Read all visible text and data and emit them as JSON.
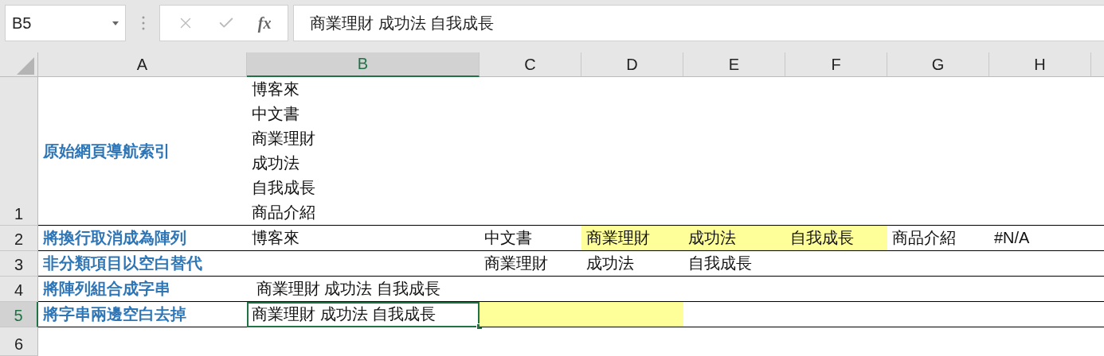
{
  "formula_bar": {
    "name_box": "B5",
    "function_label": "fx",
    "formula": "商業理財 成功法 自我成長"
  },
  "columns": [
    {
      "label": "A",
      "selected": false
    },
    {
      "label": "B",
      "selected": true
    },
    {
      "label": "C",
      "selected": false
    },
    {
      "label": "D",
      "selected": false
    },
    {
      "label": "E",
      "selected": false
    },
    {
      "label": "F",
      "selected": false
    },
    {
      "label": "G",
      "selected": false
    },
    {
      "label": "H",
      "selected": false
    }
  ],
  "rows": [
    {
      "number": "1",
      "selected": false,
      "cells": [
        {
          "lines": [
            "原始網頁導航索引"
          ],
          "selected": false
        },
        {
          "lines": [
            "博客來",
            "中文書",
            "商業理財",
            "成功法",
            "自我成長",
            "商品介紹"
          ],
          "selected": false
        },
        {
          "selected": false
        },
        {
          "selected": false
        },
        {
          "selected": false
        },
        {
          "selected": false
        },
        {
          "selected": false
        },
        {
          "selected": false
        }
      ]
    },
    {
      "number": "2",
      "selected": false,
      "cells": [
        {
          "lines": [
            "將換行取消成為陣列"
          ],
          "selected": false
        },
        {
          "lines": [
            "博客來"
          ],
          "selected": false
        },
        {
          "lines": [
            "中文書"
          ],
          "selected": false
        },
        {
          "lines": [
            "商業理財"
          ],
          "color": "#ffff99",
          "selected": false
        },
        {
          "lines": [
            "成功法"
          ],
          "color": "#ffff99",
          "selected": false
        },
        {
          "lines": [
            "自我成長"
          ],
          "color": "#ffff99",
          "selected": false
        },
        {
          "lines": [
            "商品介紹"
          ],
          "selected": false
        },
        {
          "lines": [
            "#N/A"
          ],
          "selected": false
        }
      ]
    },
    {
      "number": "3",
      "selected": false,
      "cells": [
        {
          "lines": [
            "非分類項目以空白替代"
          ],
          "selected": false
        },
        {
          "selected": false
        },
        {
          "lines": [
            "商業理財"
          ],
          "selected": false
        },
        {
          "lines": [
            "成功法"
          ],
          "selected": false
        },
        {
          "lines": [
            "自我成長"
          ],
          "selected": false
        },
        {
          "selected": false
        },
        {
          "selected": false
        },
        {
          "selected": false
        }
      ]
    },
    {
      "number": "4",
      "selected": false,
      "cells": [
        {
          "lines": [
            "將陣列組合成字串"
          ],
          "selected": false
        },
        {
          "lines": [
            " 商業理財 成功法 自我成長"
          ],
          "selected": false
        },
        {
          "selected": false
        },
        {
          "selected": false
        },
        {
          "selected": false
        },
        {
          "selected": false
        },
        {
          "selected": false
        },
        {
          "selected": false
        }
      ]
    },
    {
      "number": "5",
      "selected": true,
      "cells": [
        {
          "lines": [
            "將字串兩邊空白去掉"
          ],
          "selected": false
        },
        {
          "lines": [
            "商業理財 成功法 自我成長"
          ],
          "selected": true
        },
        {
          "color": "#ffff99",
          "selected": false
        },
        {
          "color": "#ffff99",
          "selected": false
        },
        {
          "selected": false
        },
        {
          "selected": false
        },
        {
          "selected": false
        },
        {
          "selected": false
        }
      ]
    },
    {
      "number": "6",
      "selected": false
    }
  ]
}
